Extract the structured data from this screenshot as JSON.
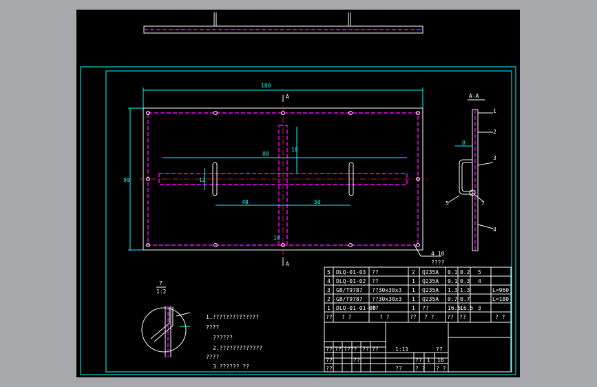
{
  "colors": {
    "background": "#000000",
    "outer_bg": "#a7a8ab",
    "frame": "#00ffff",
    "white": "#ffffff",
    "magenta": "#ff00ff",
    "red": "#ff3030",
    "dim": "#00ffff"
  },
  "drawing": {
    "section_marker": "A",
    "section_title": "A-A",
    "dim_width": "180",
    "dim_height": "90",
    "dim_inner_top": "88",
    "dim_inner_v": "18",
    "dim_bottom_left": "48",
    "dim_bottom_right": "50",
    "dim_left_short": "12",
    "dim_bottom_small": "10",
    "dim_section_width": "8",
    "balloon_1": "1",
    "balloon_2": "2",
    "balloon_3": "3",
    "balloon_4": "4",
    "balloon_5": "5",
    "balloon_7": "7",
    "weld_symbol": "4 10",
    "weld_label": "????",
    "detail_label_top": "7",
    "detail_label_bottom": "1:2"
  },
  "notes": {
    "line1": "1.??????????????",
    "line2": "????",
    "line3": "??????",
    "line4": "2.?????????????",
    "line5": "????",
    "line6": "3.??????  ??"
  },
  "bom": {
    "rows": [
      {
        "no": "5",
        "code": "DLQ-01-03",
        "name": "??",
        "qty": "2",
        "material": "Q235A",
        "w1": "0.1",
        "w2": "0.2",
        "remark": "5"
      },
      {
        "no": "4",
        "code": "DLQ-01-02",
        "name": "??",
        "qty": "1",
        "material": "Q235A",
        "w1": "0.1",
        "w2": "0.3",
        "remark": "4"
      },
      {
        "no": "3",
        "code": "GB/T9787",
        "name": "??30x30x3",
        "qty": "1",
        "material": "Q235A",
        "w1": "1.3",
        "w2": "1.3",
        "remark": "L=960"
      },
      {
        "no": "2",
        "code": "GB/T9787",
        "name": "??30x30x3",
        "qty": "1",
        "material": "Q235A",
        "w1": "0.7",
        "w2": "0.7",
        "remark": "L=180"
      },
      {
        "no": "1",
        "code": "DLQ-01-01-00",
        "name": "??",
        "qty": "1",
        "material": "??",
        "w1": "16.5",
        "w2": "16.5",
        "remark": "3"
      }
    ],
    "header": {
      "no": "??",
      "code": "? ?",
      "name": "? ?",
      "qty": "??",
      "material": "? ?",
      "w1": "??",
      "w2": "??",
      "remark": "? ?"
    }
  },
  "title_block": {
    "cells": [
      "??",
      "??",
      "????",
      "??",
      "??",
      "??",
      "??",
      "??",
      "1:11",
      "??",
      "??",
      "1",
      "16",
      "??",
      "? ?",
      "? ?"
    ]
  }
}
